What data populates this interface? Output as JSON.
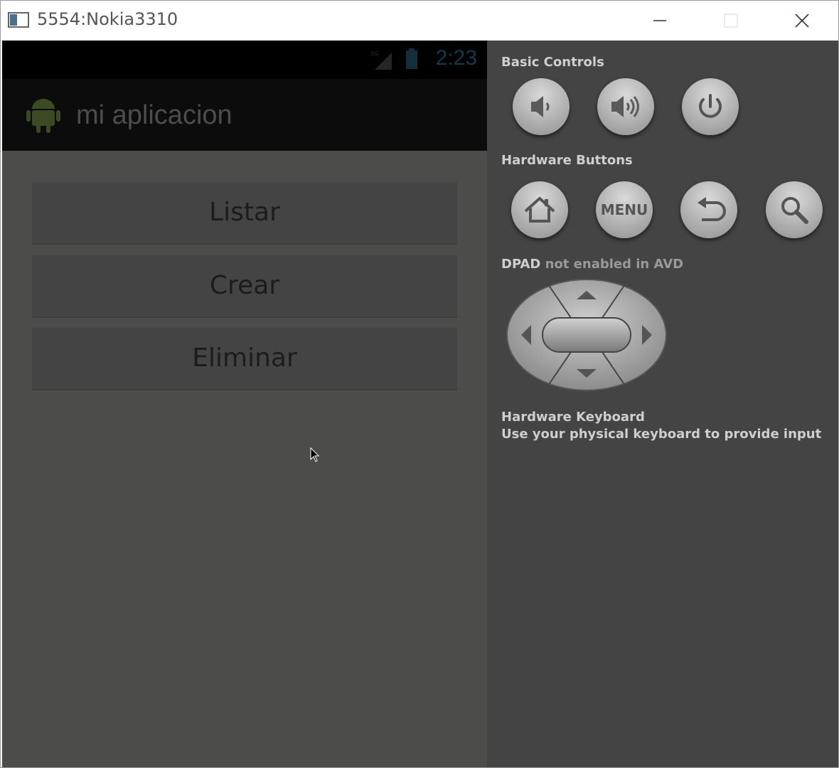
{
  "window": {
    "title": "5554:Nokia3310",
    "buttons": [
      "minimize",
      "maximize",
      "close"
    ]
  },
  "device": {
    "status_bar": {
      "clock": "2:23"
    },
    "action_bar": {
      "app_title": "mi aplicacion",
      "icon": "android-icon"
    },
    "buttons": [
      {
        "label": "Listar"
      },
      {
        "label": "Crear"
      },
      {
        "label": "Eliminar"
      }
    ]
  },
  "controls": {
    "basic_controls_label": "Basic Controls",
    "basic_controls": [
      "volume-down-icon",
      "volume-up-icon",
      "power-icon"
    ],
    "hardware_buttons_label": "Hardware Buttons",
    "hardware_buttons": [
      "home-icon",
      "menu",
      "back-icon",
      "search-icon"
    ],
    "menu_label": "MENU",
    "dpad_label_bold": "DPAD",
    "dpad_label_rest": " not enabled in AVD",
    "keyboard_title": "Hardware Keyboard",
    "keyboard_desc": "Use your physical keyboard to provide input"
  },
  "colors": {
    "screen_bg": "#4c4c4b",
    "panel_bg": "#444444",
    "action_bar": "#0c0c0c"
  }
}
